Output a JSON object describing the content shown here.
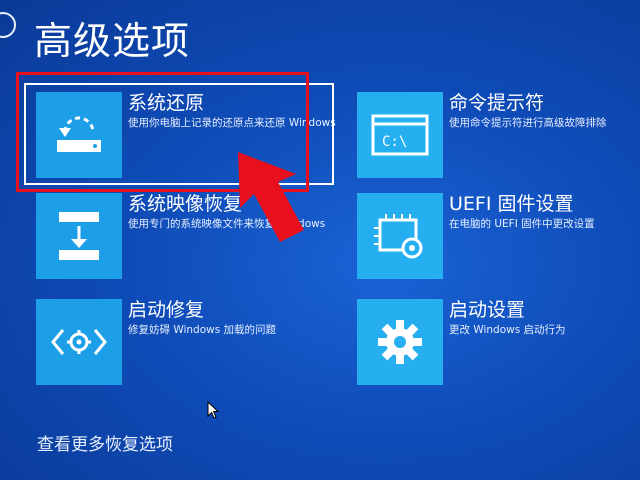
{
  "page": {
    "title": "高级选项"
  },
  "tiles": [
    {
      "title": "系统还原",
      "desc": "使用你电脑上记录的还原点来还原 Windows",
      "icon": "restore-icon"
    },
    {
      "title": "命令提示符",
      "desc": "使用命令提示符进行高级故障排除",
      "icon": "command-prompt-icon"
    },
    {
      "title": "系统映像恢复",
      "desc": "使用专门的系统映像文件来恢复 Windows",
      "icon": "image-recovery-icon"
    },
    {
      "title": "UEFI 固件设置",
      "desc": "在电脑的 UEFI 固件中更改设置",
      "icon": "firmware-chip-icon"
    },
    {
      "title": "启动修复",
      "desc": "修复妨碍 Windows 加载的问题",
      "icon": "startup-repair-icon"
    },
    {
      "title": "启动设置",
      "desc": "更改 Windows 启动行为",
      "icon": "gear-icon"
    }
  ],
  "footer": {
    "more_options": "查看更多恢复选项"
  },
  "colors": {
    "background": "#0f4cb8",
    "tile": "#1d9fe8",
    "highlight": "#e8101d"
  }
}
